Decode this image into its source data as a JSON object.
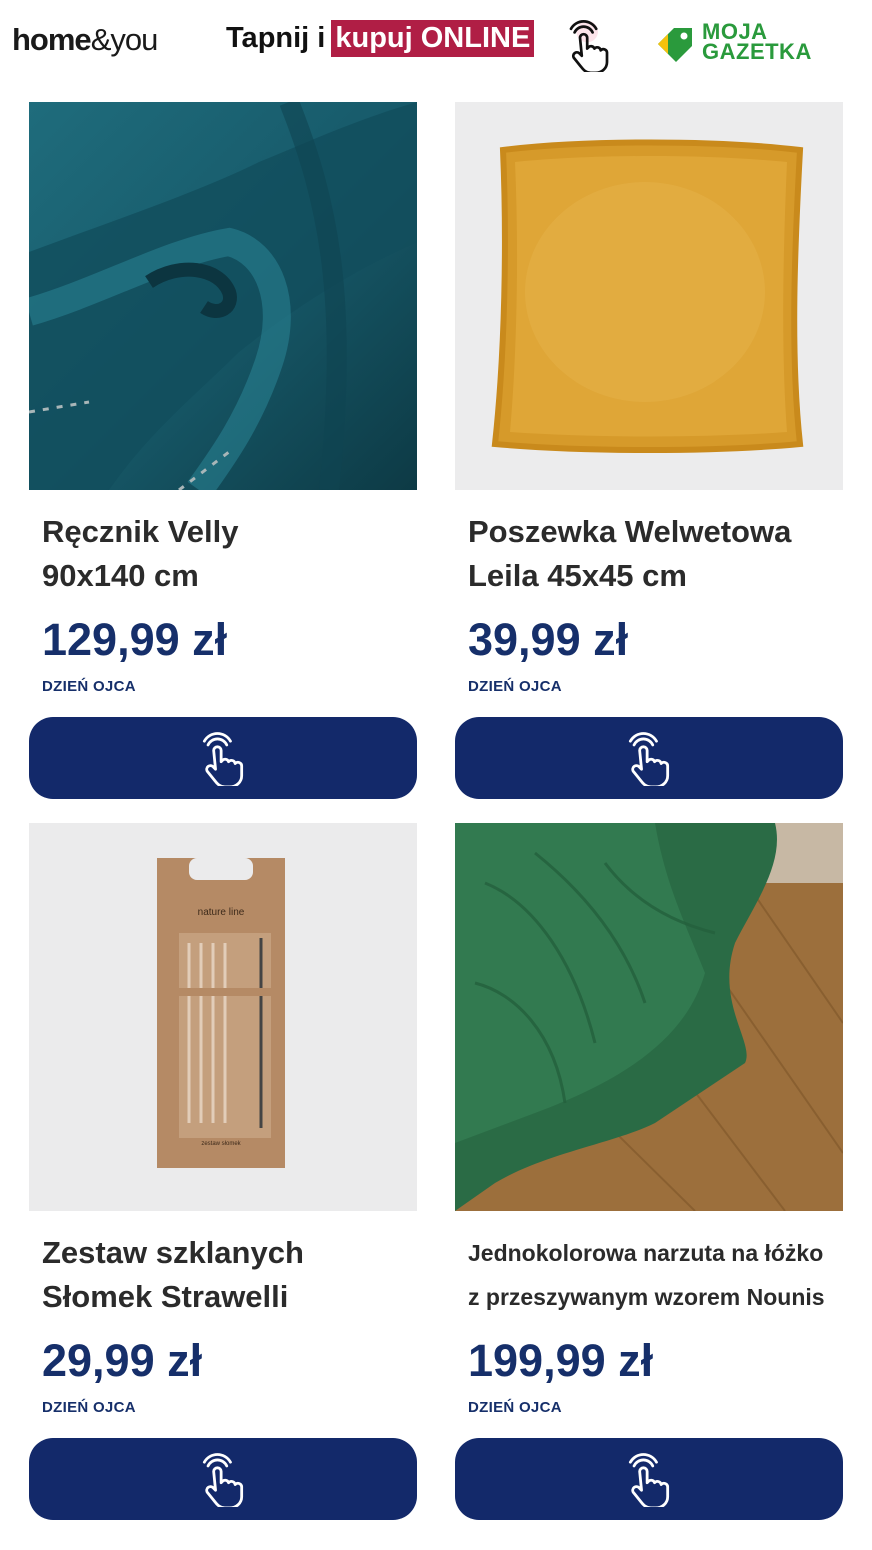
{
  "header": {
    "logo_home": "home",
    "logo_you": "&you",
    "tap_prefix": "Tapnij i",
    "tap_highlight": "kupuj ONLINE",
    "partner_line1": "MOJA",
    "partner_line2": "GAZETKA",
    "icons": [
      "tap-hand-icon",
      "moja-gazetka-tag-icon"
    ]
  },
  "colors": {
    "brand_blue": "#13296a",
    "price_blue": "#162f6a",
    "highlight_red": "#b01e45",
    "partner_green": "#2a9a3c"
  },
  "products": [
    {
      "title_line1": "Ręcznik Velly",
      "title_line2": "90x140 cm",
      "price": "129,99 zł",
      "tag": "DZIEŃ OJCA",
      "image": "teal towel"
    },
    {
      "title_line1": "Poszewka Welwetowa",
      "title_line2": "Leila 45x45 cm",
      "price": "39,99 zł",
      "tag": "DZIEŃ OJCA",
      "image": "mustard velvet cushion"
    },
    {
      "title_line1": "Zestaw szklanych",
      "title_line2": "Słomek Strawelli",
      "price": "29,99 zł",
      "tag": "DZIEŃ OJCA",
      "image": "glass straws box",
      "box_text1": "nature line",
      "box_text2": "zestaw słomek"
    },
    {
      "title_line1": "Jednokolorowa narzuta na łóżko",
      "title_line2": "z przeszywanym wzorem Nounis",
      "price": "199,99 zł",
      "tag": "DZIEŃ OJCA",
      "image": "green quilted bedspread"
    }
  ]
}
